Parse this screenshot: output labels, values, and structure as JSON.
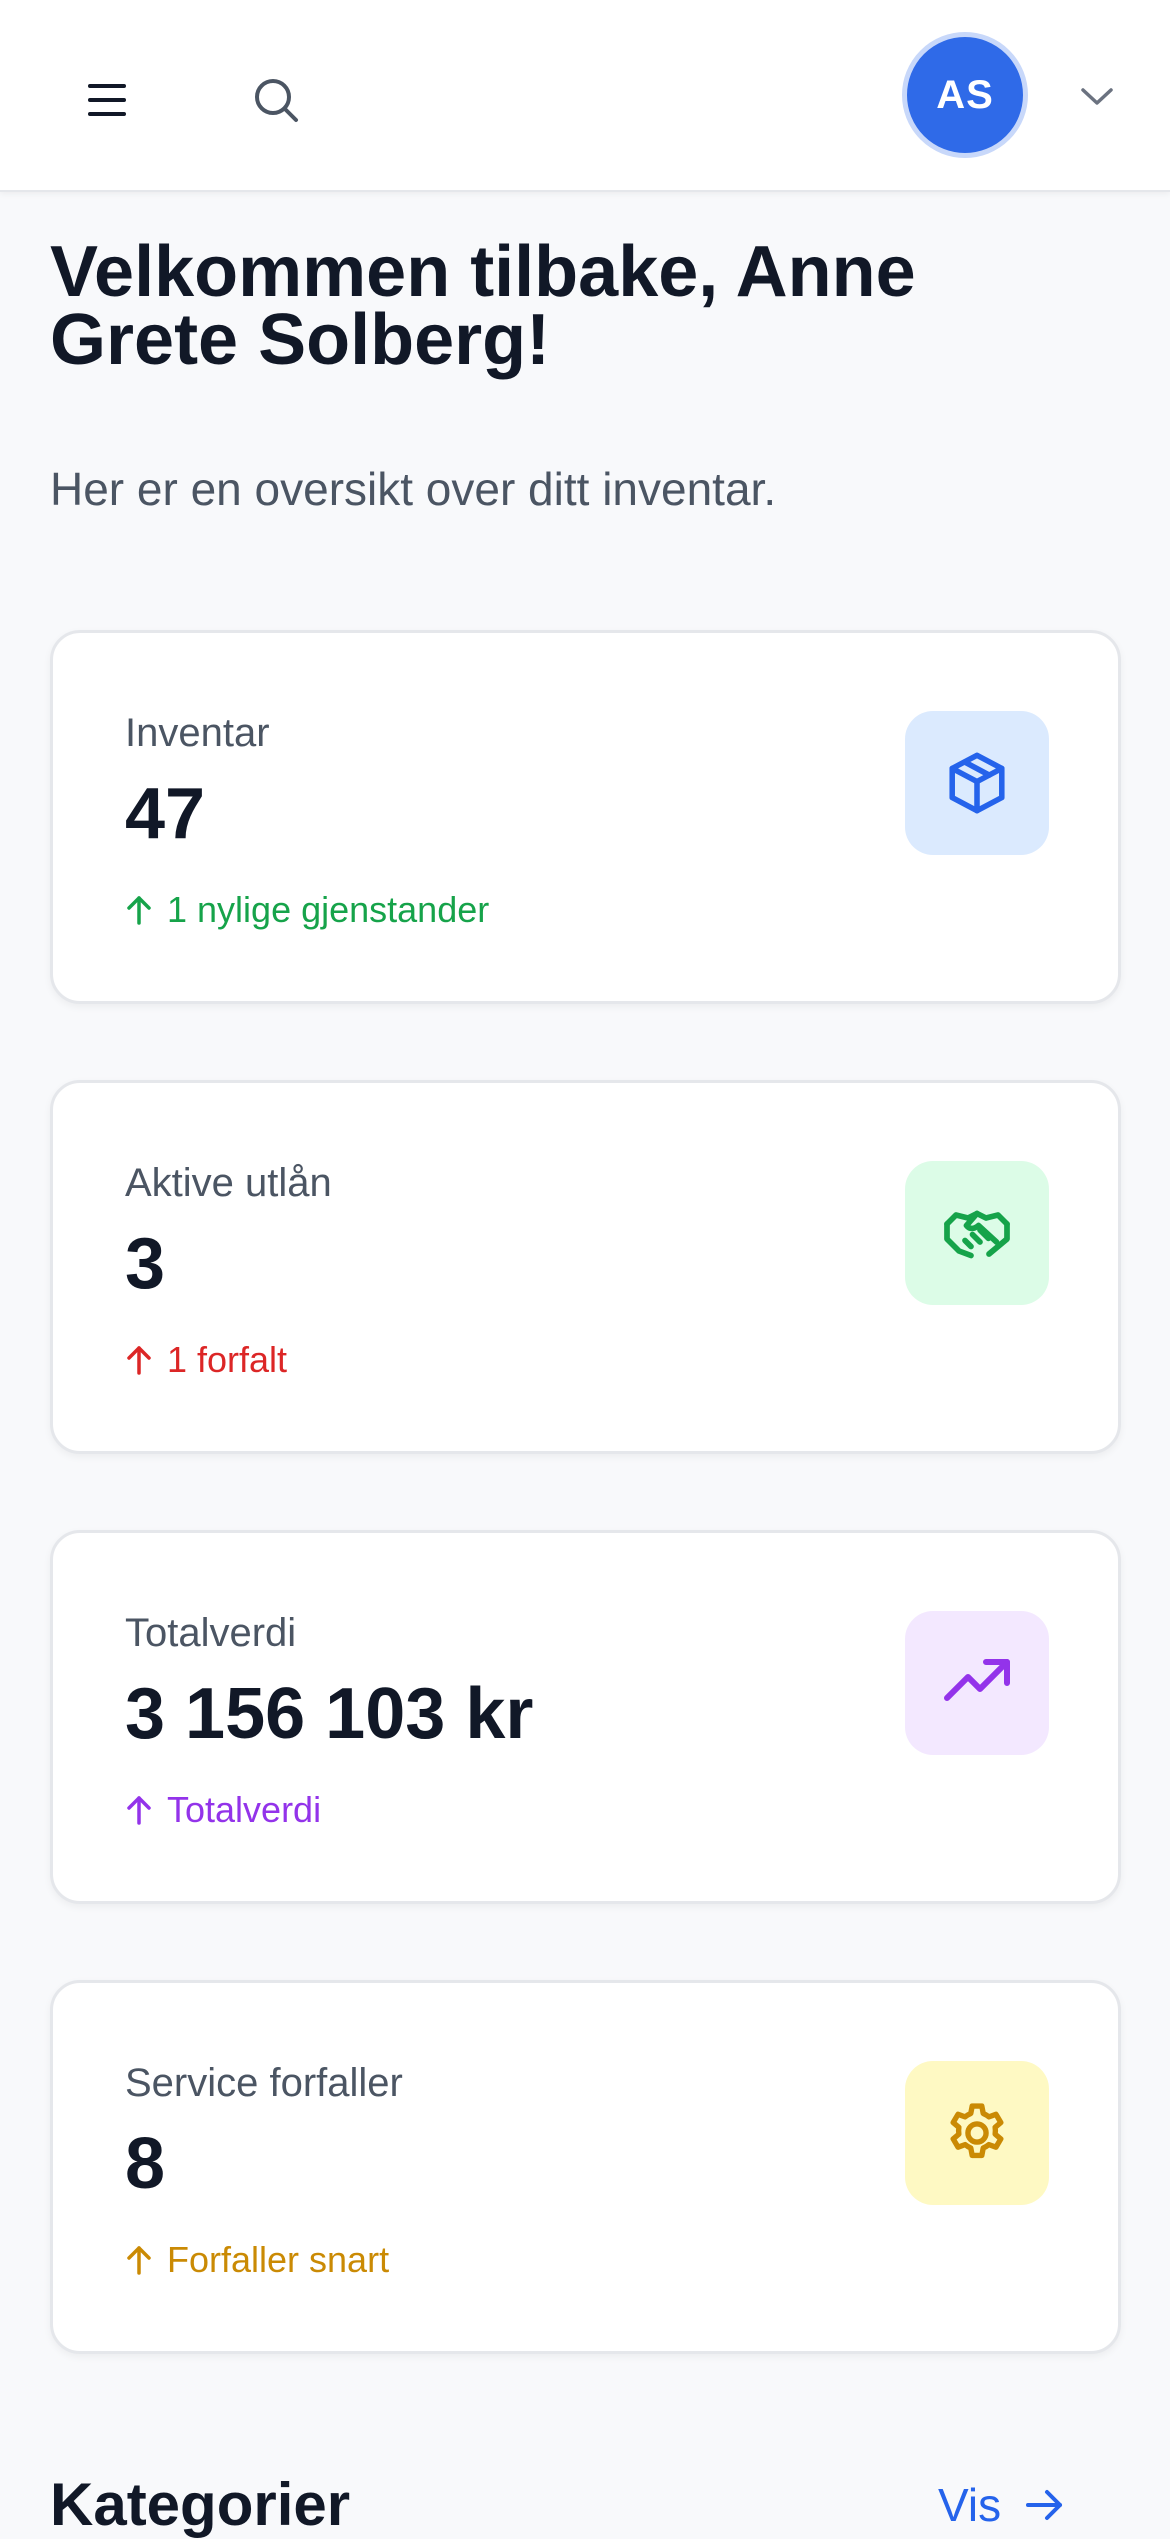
{
  "header": {
    "avatar_initials": "AS"
  },
  "welcome": {
    "title": "Velkommen tilbake, Anne Grete Solberg!",
    "subtitle": "Her er en oversikt over ditt inventar."
  },
  "stats": [
    {
      "label": "Inventar",
      "value": "47",
      "trend": "1 nylige gjenstander",
      "icon": "box-icon",
      "trend_color": "#16a34a",
      "icon_bg": "#dbeafe",
      "icon_color": "#2563eb"
    },
    {
      "label": "Aktive utlån",
      "value": "3",
      "trend": "1 forfalt",
      "icon": "handshake-icon",
      "trend_color": "#dc2626",
      "icon_bg": "#dcfce7",
      "icon_color": "#16a34a"
    },
    {
      "label": "Totalverdi",
      "value": "3 156 103 kr",
      "trend": "Totalverdi",
      "icon": "trending-up-icon",
      "trend_color": "#9333ea",
      "icon_bg": "#f3e8ff",
      "icon_color": "#9333ea"
    },
    {
      "label": "Service forfaller",
      "value": "8",
      "trend": "Forfaller snart",
      "icon": "gear-icon",
      "trend_color": "#ca8a04",
      "icon_bg": "#fef9c3",
      "icon_color": "#ca8a04"
    }
  ],
  "categories": {
    "title": "Kategorier",
    "link": "Vis"
  }
}
